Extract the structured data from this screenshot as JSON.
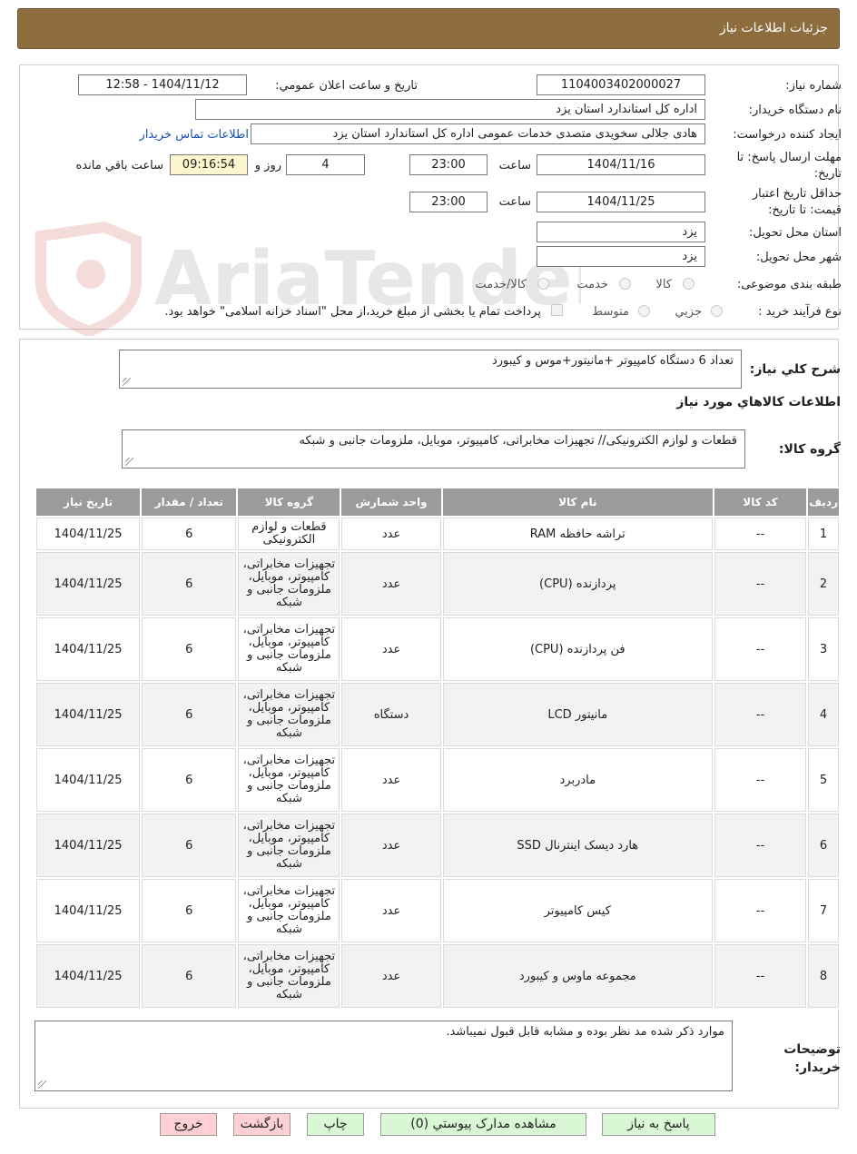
{
  "header": {
    "title": "جزئیات اطلاعات نیاز"
  },
  "form": {
    "need_number_label": "شماره نیاز:",
    "need_number": "1104003402000027",
    "announce_label": "تاریخ و ساعت اعلان عمومي:",
    "announce_value": "1404/11/12 - 12:58",
    "buyer_org_label": "نام دستگاه خریدار:",
    "buyer_org": "اداره کل استاندارد استان یزد",
    "creator_label": "ایجاد کننده درخواست:",
    "creator": "هادی جلالی سخویدی متصدی خدمات عمومی اداره کل استاندارد استان یزد",
    "contact_link": "اطلاعات تماس خریدار",
    "deadline_label": "مهلت ارسال پاسخ: تا تاریخ:",
    "deadline_date": "1404/11/16",
    "time_label": "ساعت",
    "deadline_time": "23:00",
    "days_value": "4",
    "days_label": "روز و",
    "remaining_time": "09:16:54",
    "remaining_label": "ساعت باقي مانده",
    "validity_label": "حداقل تاریخ اعتبار قیمت: تا تاریخ:",
    "validity_date": "1404/11/25",
    "validity_time_label": "ساعت",
    "validity_time": "23:00",
    "province_label": "استان محل تحویل:",
    "province": "یزد",
    "city_label": "شهر محل تحویل:",
    "city": "یزد",
    "category_label": "طبقه بندی موضوعی:",
    "category_options": [
      "کالا",
      "خدمت",
      "کالا/خدمت"
    ],
    "process_label": "نوع فرآیند خرید :",
    "process_options": [
      "جزیي",
      "متوسط"
    ],
    "payment_note": "پرداخت تمام یا بخشی از مبلغ خرید،از محل \"اسناد خزانه اسلامی\" خواهد بود."
  },
  "watermark": {
    "text": "AriaTender.net"
  },
  "summary": {
    "label": "شرح كلي نیاز:",
    "value": "تعداد 6 دستگاه کامپیوتر +مانیتور+موس و کیبورد",
    "goods_info_title": "اطلاعات كالاهاي مورد نیاز",
    "goods_group_label": "گروه کالا:",
    "goods_group_value": "قطعات و لوازم الکترونیکی// تجهیزات مخابراتی، کامپیوتر، موبایل، ملزومات جانبی و شبکه"
  },
  "table": {
    "headers": [
      "ردیف",
      "کد کالا",
      "نام کالا",
      "واحد شمارش",
      "گروه کالا",
      "تعداد / مقدار",
      "تاریخ نیاز"
    ],
    "rows": [
      {
        "idx": "1",
        "code": "--",
        "name": "تراشه حافظه RAM",
        "unit": "عدد",
        "group": "قطعات و لوازم الکترونیکی",
        "qty": "6",
        "date": "1404/11/25"
      },
      {
        "idx": "2",
        "code": "--",
        "name": "پردازنده (CPU)",
        "unit": "عدد",
        "group": "تجهیزات مخابراتی، کامپیوتر، موبایل، ملزومات جانبی و شبکه",
        "qty": "6",
        "date": "1404/11/25"
      },
      {
        "idx": "3",
        "code": "--",
        "name": "فن پردازنده (CPU)",
        "unit": "عدد",
        "group": "تجهیزات مخابراتی، کامپیوتر، موبایل، ملزومات جانبی و شبکه",
        "qty": "6",
        "date": "1404/11/25"
      },
      {
        "idx": "4",
        "code": "--",
        "name": "مانیتور LCD",
        "unit": "دستگاه",
        "group": "تجهیزات مخابراتی، کامپیوتر، موبایل، ملزومات جانبی و شبکه",
        "qty": "6",
        "date": "1404/11/25"
      },
      {
        "idx": "5",
        "code": "--",
        "name": "مادربرد",
        "unit": "عدد",
        "group": "تجهیزات مخابراتی، کامپیوتر، موبایل، ملزومات جانبی و شبکه",
        "qty": "6",
        "date": "1404/11/25"
      },
      {
        "idx": "6",
        "code": "--",
        "name": "هارد دیسک اینترنال SSD",
        "unit": "عدد",
        "group": "تجهیزات مخابراتی، کامپیوتر، موبایل، ملزومات جانبی و شبکه",
        "qty": "6",
        "date": "1404/11/25"
      },
      {
        "idx": "7",
        "code": "--",
        "name": "کیس کامپیوتر",
        "unit": "عدد",
        "group": "تجهیزات مخابراتی، کامپیوتر، موبایل، ملزومات جانبی و شبکه",
        "qty": "6",
        "date": "1404/11/25"
      },
      {
        "idx": "8",
        "code": "--",
        "name": "مجموعه ماوس و کیبورد",
        "unit": "عدد",
        "group": "تجهیزات مخابراتی، کامپیوتر، موبایل، ملزومات جانبی و شبکه",
        "qty": "6",
        "date": "1404/11/25"
      }
    ]
  },
  "notes": {
    "label": "توضیحات خریدار:",
    "value": "موارد ذکر شده مد نظر بوده و مشابه قابل قبول نمیباشد."
  },
  "buttons": {
    "reply": "پاسخ به نیاز",
    "view_docs": "مشاهده مدارک پیوستي (0)",
    "print": "چاپ",
    "back": "بازگشت",
    "exit": "خروج"
  },
  "colors": {
    "header_bg": "#8d6d3d",
    "table_header_bg": "#9b9b9b",
    "green_button": "#d9f7d4",
    "pink_button": "#ffd0d3",
    "remaining_bg": "#fdf6cf",
    "link": "#1a4fb7"
  }
}
